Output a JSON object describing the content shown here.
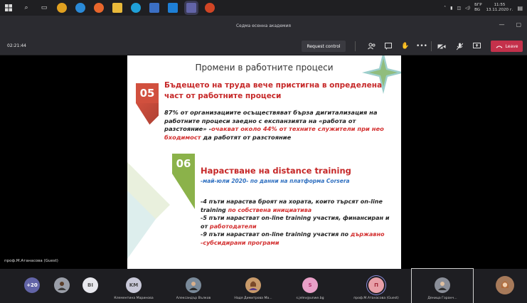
{
  "window": {
    "title": "Седма есенна академия"
  },
  "clock": {
    "lang": "БГР",
    "lang2": "BG",
    "time": "11:55",
    "date": "13.11.2020 г."
  },
  "toolbar": {
    "timer": "02:21:44",
    "request_control": "Request control",
    "leave": "Leave"
  },
  "stage": {
    "presenter": "проф.М.Атанасова (Guest)"
  },
  "slide": {
    "title": "Промени в работните процеси",
    "s1": {
      "num": "05",
      "heading": "Бъдещето на труда вече пристигна в определена част от работните процеси",
      "p1": "87% от организациите осъществяват бърза дигитализация на работните процеси заедно с експанзията на «работа от разстояние» -",
      "p1_red": "очакват около 44% от техните служители при нео бходимост",
      "p1_end": " да работят от разстояние"
    },
    "s2": {
      "num": "06",
      "heading": "Нарастване на distance training",
      "sub": "-май-юли 2020- по данни на платформа Corsera",
      "l1": "-4 пъти нараства броят на хората, които търсят on-line training ",
      "l1_red": "по собствена инициатива",
      "l2": "-5 пъти нарастват on-line training участия, финансиран и от ",
      "l2_red": "работодатели",
      "l3": "-9 пъти нарастват on-line training участия  по ",
      "l3_red": "държавно -субсидирани програми"
    }
  },
  "participants": {
    "more": "+20",
    "bi": "BI",
    "km_initials": "KM",
    "km": "Клементина Маринова",
    "a": "Александър Вълков",
    "n": "Надя Димитрова Ма...",
    "s_initial": "S",
    "s": "s.jelev@unwe.bg",
    "p_initial": "П",
    "p": "проф.М.Атанасова (Guest)",
    "d": "Деница Горанч..."
  },
  "colors": {
    "leave": "#c4314b",
    "num05": "#d1503e",
    "num06": "#8bb24a",
    "subtitle": "#2e6fc0"
  }
}
